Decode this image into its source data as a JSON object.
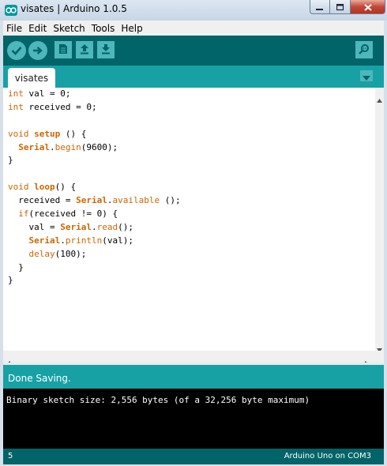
{
  "window": {
    "title": "visates | Arduino 1.0.5"
  },
  "menu": [
    "File",
    "Edit",
    "Sketch",
    "Tools",
    "Help"
  ],
  "toolbar": {
    "buttons": [
      "verify-icon",
      "upload-icon",
      "new-icon",
      "open-icon",
      "save-icon"
    ],
    "serial_monitor_icon": "serial-monitor-icon"
  },
  "tabs": [
    {
      "label": "visates"
    }
  ],
  "editor": {
    "lines": [
      [
        {
          "t": "int",
          "c": "kw"
        },
        {
          "t": " val = 0;"
        }
      ],
      [
        {
          "t": "int",
          "c": "kw"
        },
        {
          "t": " received = 0;"
        }
      ],
      [],
      [
        {
          "t": "void",
          "c": "kw"
        },
        {
          "t": " "
        },
        {
          "t": "setup",
          "c": "kwb"
        },
        {
          "t": " () {"
        }
      ],
      [
        {
          "t": "  "
        },
        {
          "t": "Serial",
          "c": "kwb"
        },
        {
          "t": "."
        },
        {
          "t": "begin",
          "c": "kw"
        },
        {
          "t": "(9600);"
        }
      ],
      [
        {
          "t": "}"
        }
      ],
      [],
      [
        {
          "t": "void",
          "c": "kw"
        },
        {
          "t": " "
        },
        {
          "t": "loop",
          "c": "kwb"
        },
        {
          "t": "() {"
        }
      ],
      [
        {
          "t": "  received = "
        },
        {
          "t": "Serial",
          "c": "kwb"
        },
        {
          "t": "."
        },
        {
          "t": "available",
          "c": "kw"
        },
        {
          "t": " ();"
        }
      ],
      [
        {
          "t": "  "
        },
        {
          "t": "if",
          "c": "kw"
        },
        {
          "t": "(received != 0) {"
        }
      ],
      [
        {
          "t": "    val = "
        },
        {
          "t": "Serial",
          "c": "kwb"
        },
        {
          "t": "."
        },
        {
          "t": "read",
          "c": "kw"
        },
        {
          "t": "();"
        }
      ],
      [
        {
          "t": "    "
        },
        {
          "t": "Serial",
          "c": "kwb"
        },
        {
          "t": "."
        },
        {
          "t": "println",
          "c": "kw"
        },
        {
          "t": "(val);"
        }
      ],
      [
        {
          "t": "    "
        },
        {
          "t": "delay",
          "c": "kw"
        },
        {
          "t": "(100);"
        }
      ],
      [
        {
          "t": "  }"
        }
      ],
      [
        {
          "t": "}"
        }
      ]
    ]
  },
  "status": {
    "message": "Done Saving."
  },
  "console": {
    "text": "Binary sketch size: 2,556 bytes (of a 32,256 byte maximum)"
  },
  "footer": {
    "line": "5",
    "board": "Arduino Uno on COM3"
  },
  "colors": {
    "toolbar": "#006468",
    "accent": "#17a1a5",
    "button": "#4db7bb",
    "keyword": "#cc6600"
  }
}
